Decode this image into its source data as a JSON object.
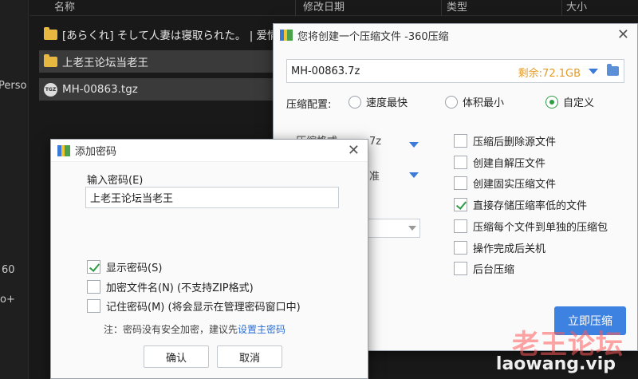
{
  "explorer": {
    "columns": [
      "名称",
      "修改日期",
      "类型",
      "大小"
    ],
    "left_labels": [
      "Perso",
      "60",
      "o+"
    ],
    "files": [
      {
        "name": "[あらくれ] そして人妻は寝取られた。 | 爱情",
        "icon": "folder-icon"
      },
      {
        "name": "上老王论坛当老王",
        "icon": "folder-icon"
      },
      {
        "name": "MH-00863.tgz",
        "icon": "tgz-icon",
        "icon_text": "TGZ"
      }
    ]
  },
  "compress_dialog": {
    "title": "您将创建一个压缩文件 -360压缩",
    "path_value": "MH-00863.7z",
    "free_space": "剩余:72.1GB",
    "config_label": "压缩配置:",
    "radios": [
      {
        "label": "速度最快",
        "checked": false
      },
      {
        "label": "体积最小",
        "checked": false
      },
      {
        "label": "自定义",
        "checked": true
      }
    ],
    "hidden_text": [
      "压缩格式",
      "7z",
      "准"
    ],
    "checkboxes": [
      {
        "label": "压缩后删除源文件",
        "checked": false
      },
      {
        "label": "创建自解压文件",
        "checked": false
      },
      {
        "label": "创建固实压缩文件",
        "checked": false
      },
      {
        "label": "直接存储压缩率低的文件",
        "checked": true
      },
      {
        "label": "压缩每个文件到单独的压缩包",
        "checked": false
      },
      {
        "label": "操作完成后关机",
        "checked": false
      },
      {
        "label": "后台压缩",
        "checked": false
      }
    ],
    "submit_label": "立即压缩"
  },
  "password_dialog": {
    "title": "添加密码",
    "input_label": "输入密码(E)",
    "input_value": "上老王论坛当老王",
    "checks": [
      {
        "label": "显示密码(S)",
        "checked": true
      },
      {
        "label": "加密文件名(N) (不支持ZIP格式)",
        "checked": false
      },
      {
        "label": "记住密码(M) (将会显示在管理密码窗口中)",
        "checked": false
      }
    ],
    "note_text": "注：密码没有安全加密，建议先",
    "note_link": "设置主密码",
    "ok_label": "确认",
    "cancel_label": "取消"
  },
  "watermark": {
    "line1": "老王论坛",
    "line2": "laowang.vip"
  },
  "colors": {
    "accent": "#3d82e0",
    "check": "#2e9c44",
    "free_space": "#e59b20",
    "watermark": "#ff5a5a"
  }
}
